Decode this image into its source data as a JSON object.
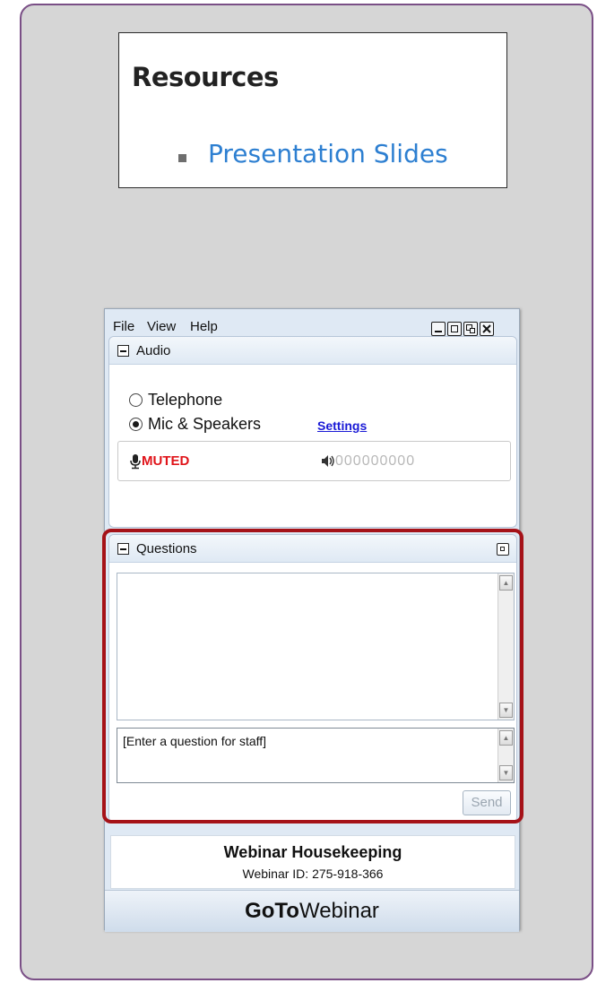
{
  "resources": {
    "title": "Resources",
    "items": [
      {
        "label": "Presentation Slides"
      }
    ]
  },
  "window": {
    "menu": [
      {
        "label": "File"
      },
      {
        "label": "View"
      },
      {
        "label": "Help"
      }
    ],
    "controls": [
      "minimize-icon",
      "maximize-icon",
      "popout-icon",
      "close-icon"
    ]
  },
  "audio": {
    "title": "Audio",
    "options": [
      {
        "label": "Telephone",
        "selected": false
      },
      {
        "label": "Mic & Speakers",
        "selected": true
      }
    ],
    "settings_label": "Settings",
    "mic_status": "MUTED",
    "level_meter": "000000000",
    "mic_status_color": "#e0141a"
  },
  "questions": {
    "title": "Questions",
    "input_value": "[Enter a question for staff]",
    "send_label": "Send"
  },
  "footer": {
    "title": "Webinar Housekeeping",
    "webinar_id": "Webinar ID: 275-918-366",
    "brand_bold": "GoTo",
    "brand_regular": "Webinar"
  },
  "colors": {
    "panel_border": "#7a4f86",
    "panel_background": "#d6d6d6",
    "highlight": "#a51218",
    "link": "#2d7fd1"
  }
}
